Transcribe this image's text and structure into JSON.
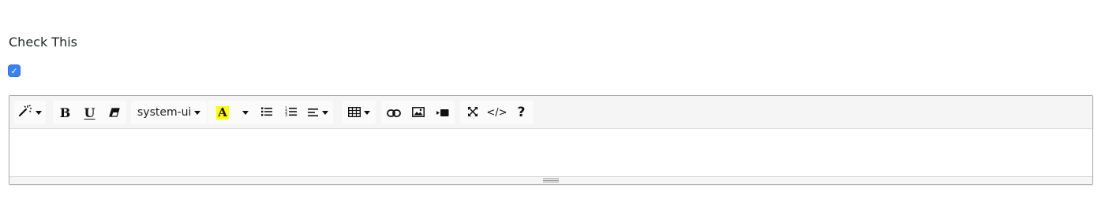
{
  "form": {
    "label": "Check This",
    "checkbox_checked": true,
    "checkbox_mark": "✓",
    "accent_color": "#3b82f6"
  },
  "toolbar": {
    "style_icon": "magic-wand-icon",
    "bold_label": "B",
    "underline_label": "U",
    "clear_format_icon": "eraser-icon",
    "font_name": "system-ui",
    "highlight_label": "A",
    "highlight_color": "#ffff00",
    "unordered_list_icon": "bulleted-list-icon",
    "ordered_list_icon": "numbered-list-icon",
    "align_icon": "align-left-icon",
    "table_icon": "table-icon",
    "link_icon": "link-icon",
    "picture_icon": "image-icon",
    "video_icon": "video-icon",
    "fullscreen_icon": "fullscreen-icon",
    "codeview_label": "</>",
    "help_label": "?"
  },
  "editor": {
    "content": ""
  }
}
